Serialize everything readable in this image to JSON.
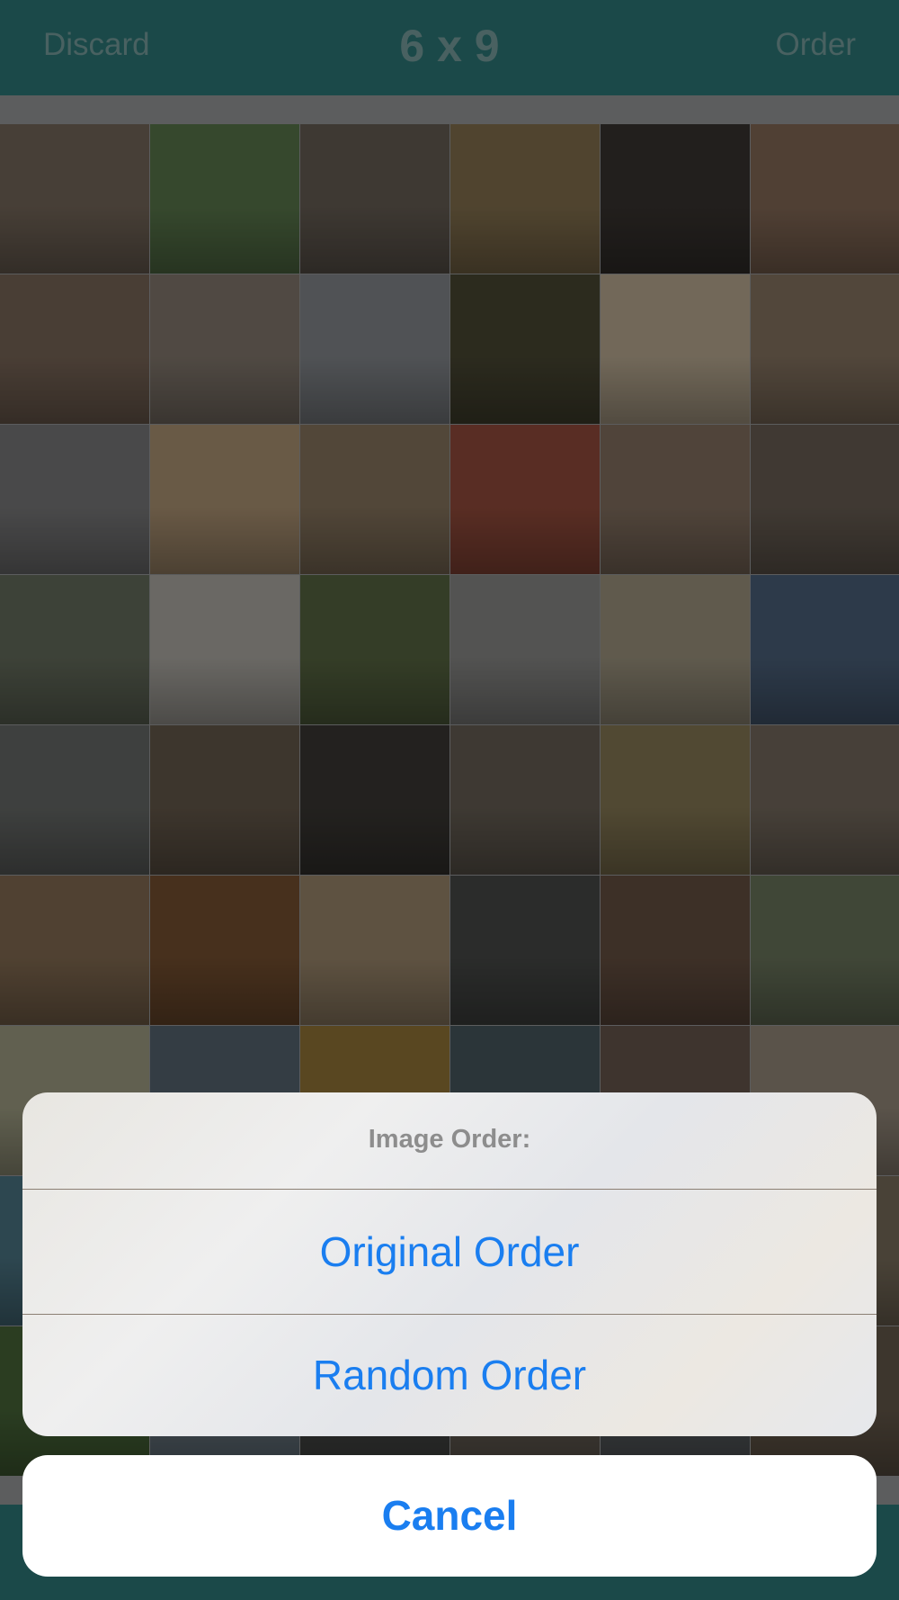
{
  "navbar": {
    "left_label": "Discard",
    "title": "6 x 9",
    "right_label": "Order"
  },
  "grid": {
    "columns": 6,
    "visible_rows": 9,
    "tile_colors": [
      "#7b6d5f",
      "#5e7d4f",
      "#6b6258",
      "#8a7652",
      "#3b3632",
      "#8b6f5b",
      "#7f6b5c",
      "#8a7f74",
      "#8a8e93",
      "#4c4a35",
      "#c4b49a",
      "#8d7a66",
      "#7f7f80",
      "#b69b79",
      "#8d7a62",
      "#9a4f3e",
      "#8a7665",
      "#6e6358",
      "#6a7261",
      "#b7b4ad",
      "#5b6a44",
      "#8f8f8d",
      "#a59c86",
      "#4f6580",
      "#6c6f6d",
      "#6a5d4e",
      "#3d3a36",
      "#6b6358",
      "#8c7e58",
      "#7a6f62",
      "#8a7156",
      "#7a5332",
      "#a38e71",
      "#4a4c4a",
      "#6a5344",
      "#6f7a60",
      "#a7a68a",
      "#5b6a75",
      "#9a7a3a",
      "#4a5c63",
      "#6b5b50",
      "#9b8f80",
      "#4f7a8a",
      "#7a6f62",
      "#3d4a3b",
      "#5a5f62",
      "#6a5d4e",
      "#7f7360",
      "#4a6a3a",
      "#6b7a84",
      "#4a4c4a",
      "#6a6258",
      "#5a5f62",
      "#6a5d4e"
    ]
  },
  "action_sheet": {
    "title": "Image Order:",
    "option_original": "Original Order",
    "option_random": "Random Order",
    "cancel_label": "Cancel"
  },
  "colors": {
    "bar": "#2f7f7e",
    "action_blue": "#1a7ef0"
  }
}
